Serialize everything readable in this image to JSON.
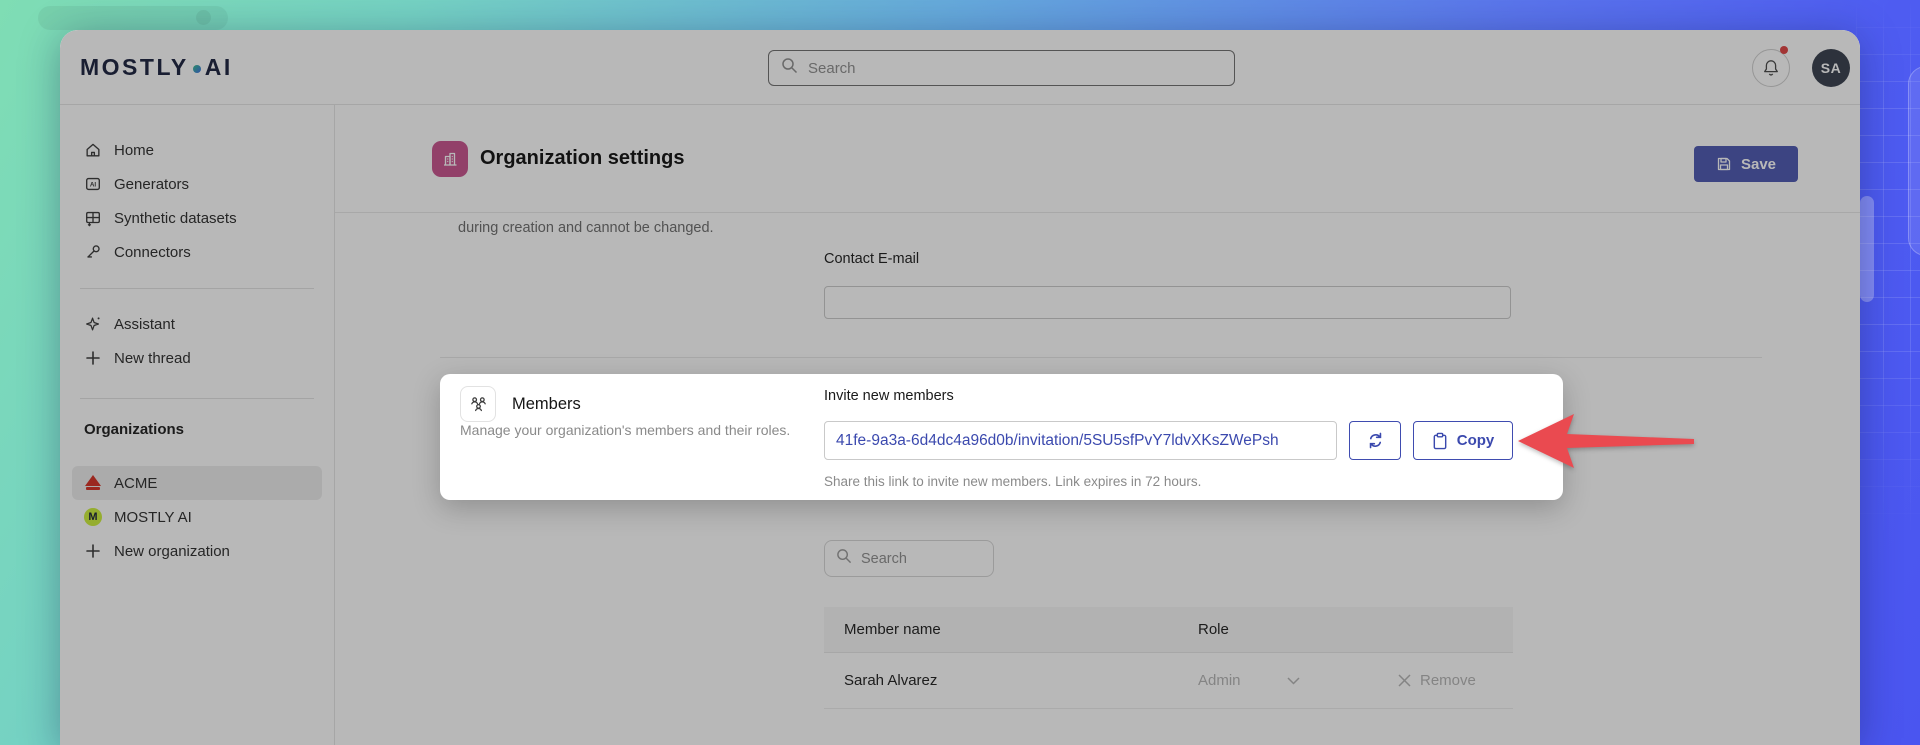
{
  "topbar": {
    "logo_left": "MOSTLY",
    "logo_right": "AI",
    "search_placeholder": "Search",
    "avatar_initials": "SA"
  },
  "sidebar": {
    "nav": [
      {
        "label": "Home"
      },
      {
        "label": "Generators"
      },
      {
        "label": "Synthetic datasets"
      },
      {
        "label": "Connectors"
      }
    ],
    "assistant": [
      {
        "label": "Assistant"
      },
      {
        "label": "New thread"
      }
    ],
    "organizations_label": "Organizations",
    "organizations": [
      {
        "label": "ACME"
      },
      {
        "label": "MOSTLY AI",
        "icon_letter": "M"
      }
    ],
    "new_organization_label": "New organization"
  },
  "page": {
    "title": "Organization settings",
    "save_label": "Save",
    "clipped_line": "during creation and cannot be changed.",
    "contact_email_label": "Contact E-mail",
    "contact_email_value": ""
  },
  "members": {
    "title": "Members",
    "description": "Manage your organization's members and their roles.",
    "invite_label": "Invite new members",
    "invite_link": "41fe-9a3a-6d4dc4a96d0b/invitation/5SU5sfPvY7ldvXKsZWePsh",
    "copy_label": "Copy",
    "helper_text": "Share this link to invite new members. Link expires in 72 hours.",
    "search_placeholder": "Search",
    "table": {
      "columns": [
        {
          "label": "Member name"
        },
        {
          "label": "Role"
        }
      ],
      "rows": [
        {
          "name": "Sarah Alvarez",
          "role": "Admin",
          "remove_label": "Remove"
        }
      ]
    }
  },
  "colors": {
    "primary_indigo": "#3B49AE",
    "save_button": "#4E59B2",
    "arrow_red": "#EA4A50",
    "org_icon_pink": "#C9538F",
    "acme_red": "#D63226",
    "mostly_lime": "#CDEF3C",
    "avatar_bg": "#39404E",
    "notification_dot": "#E04343"
  }
}
